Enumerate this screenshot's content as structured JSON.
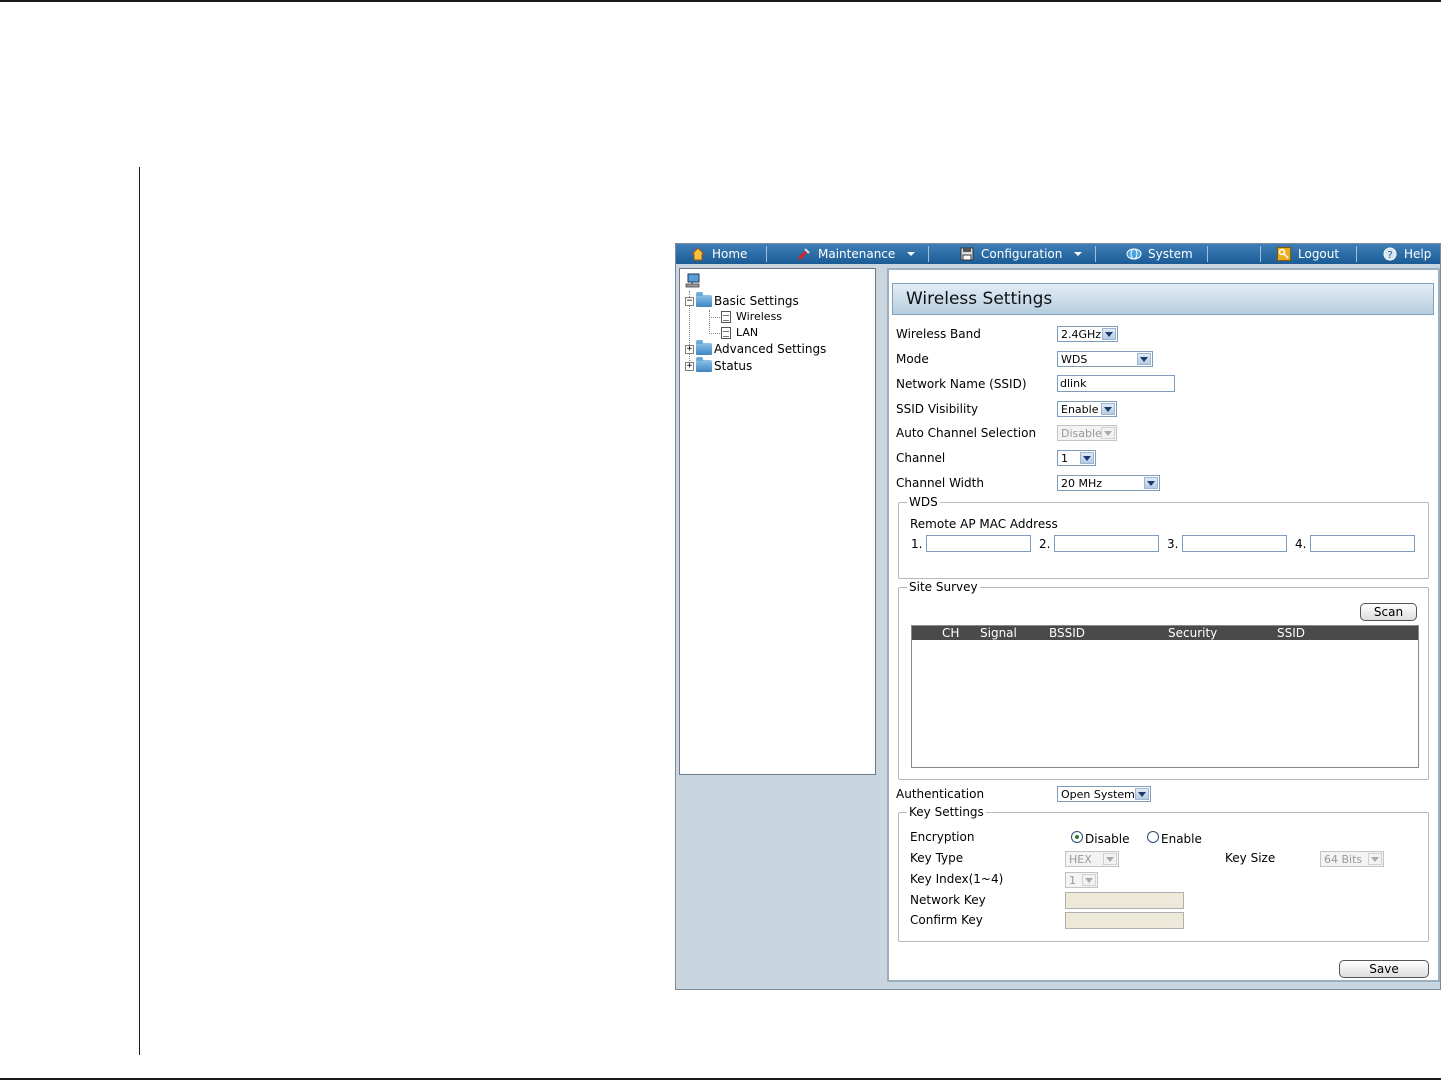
{
  "menubar": {
    "items": [
      {
        "label": "Home",
        "icon": "home-icon"
      },
      {
        "label": "Maintenance",
        "icon": "tools-icon"
      },
      {
        "label": "Configuration",
        "icon": "floppy-disk-icon"
      },
      {
        "label": "System",
        "icon": "system-icon"
      },
      {
        "label": "Logout",
        "icon": "key-icon"
      },
      {
        "label": "Help",
        "icon": "help-icon"
      }
    ]
  },
  "tree": {
    "root_icon": "network-computer-icon",
    "nodes": [
      {
        "label": "Basic Settings",
        "expander": "⊟"
      },
      {
        "label": "Wireless"
      },
      {
        "label": "LAN"
      },
      {
        "label": "Advanced Settings",
        "expander": "⊞"
      },
      {
        "label": "Status",
        "expander": "⊞"
      }
    ]
  },
  "content": {
    "title": "Wireless Settings",
    "fields": {
      "wireless_band": {
        "label": "Wireless Band",
        "value": "2.4GHz"
      },
      "mode": {
        "label": "Mode",
        "value": "WDS"
      },
      "ssid": {
        "label": "Network Name (SSID)",
        "value": "dlink"
      },
      "ssid_visibility": {
        "label": "SSID Visibility",
        "value": "Enable"
      },
      "auto_channel": {
        "label": "Auto Channel Selection",
        "value": "Disable"
      },
      "channel": {
        "label": "Channel",
        "value": "1"
      },
      "channel_width": {
        "label": "Channel Width",
        "value": "20 MHz"
      },
      "authentication": {
        "label": "Authentication",
        "value": "Open System"
      }
    },
    "wds": {
      "legend": "WDS",
      "remote_label": "Remote AP MAC Address",
      "slots": [
        {
          "num": "1.",
          "value": ""
        },
        {
          "num": "2.",
          "value": ""
        },
        {
          "num": "3.",
          "value": ""
        },
        {
          "num": "4.",
          "value": ""
        }
      ]
    },
    "site_survey": {
      "legend": "Site Survey",
      "scan_label": "Scan",
      "columns": [
        "CH",
        "Signal",
        "BSSID",
        "Security",
        "SSID"
      ]
    },
    "key_settings": {
      "legend": "Key Settings",
      "encryption_label": "Encryption",
      "encryption_options": [
        "Disable",
        "Enable"
      ],
      "encryption_selected": "Disable",
      "key_type_label": "Key Type",
      "key_type_value": "HEX",
      "key_size_label": "Key Size",
      "key_size_value": "64 Bits",
      "key_index_label": "Key Index(1~4)",
      "key_index_value": "1",
      "network_key_label": "Network Key",
      "confirm_key_label": "Confirm Key"
    },
    "save_label": "Save"
  }
}
